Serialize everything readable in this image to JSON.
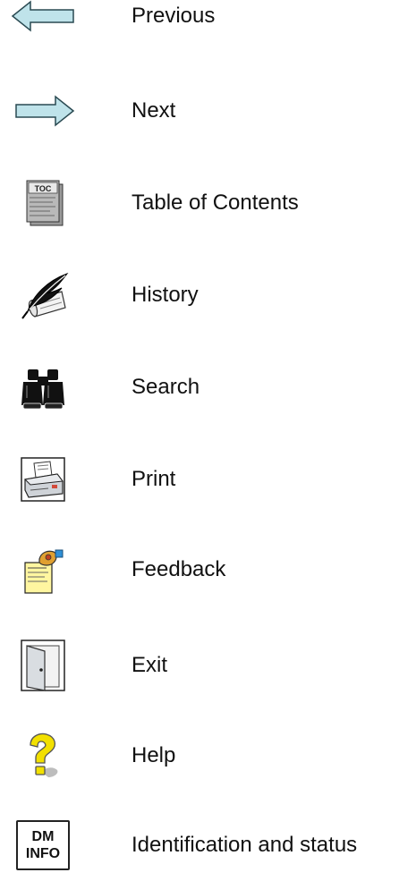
{
  "legend": {
    "items": [
      {
        "icon": "previous-arrow-icon",
        "label": "Previous"
      },
      {
        "icon": "next-arrow-icon",
        "label": "Next"
      },
      {
        "icon": "table-of-contents-icon",
        "label": "Table of Contents",
        "badge": "TOC"
      },
      {
        "icon": "history-quill-icon",
        "label": "History"
      },
      {
        "icon": "binoculars-icon",
        "label": "Search"
      },
      {
        "icon": "printer-icon",
        "label": "Print"
      },
      {
        "icon": "feedback-icon",
        "label": "Feedback"
      },
      {
        "icon": "exit-door-icon",
        "label": "Exit"
      },
      {
        "icon": "help-question-icon",
        "label": "Help"
      },
      {
        "icon": "dm-info-icon",
        "label": "Identification and status",
        "badge_line1": "DM",
        "badge_line2": "INFO"
      }
    ]
  },
  "colors": {
    "arrow_fill": "#bfe3ea",
    "help_yellow": "#f2e000",
    "note_yellow": "#fff6a0",
    "printer_gray": "#cfd3d8"
  }
}
